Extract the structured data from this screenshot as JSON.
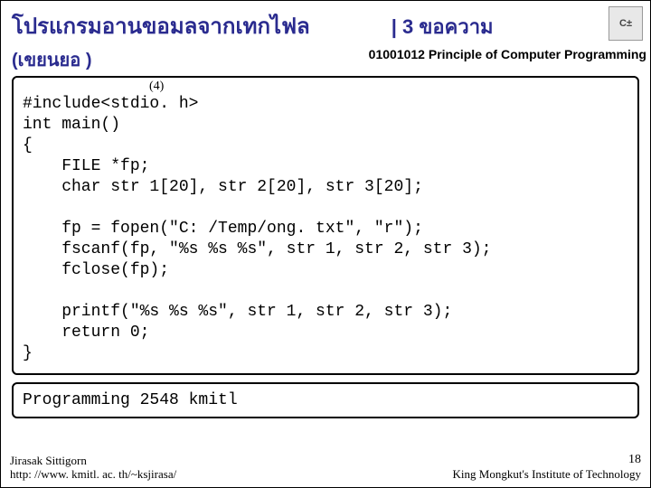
{
  "title_main": "โปรแกรมอานขอมลจากเทกไฟล",
  "title_right": "| 3 ขอความ",
  "sub_left": "(เขยนยอ    )",
  "course": "01001012 Principle of Computer Programming",
  "badge": "C±",
  "box_num": "(4)",
  "code_text": "#include<stdio. h>\nint main()\n{\n    FILE *fp;\n    char str 1[20], str 2[20], str 3[20];\n\n    fp = fopen(\"C: /Temp/ong. txt\", \"r\");\n    fscanf(fp, \"%s %s %s\", str 1, str 2, str 3);\n    fclose(fp);\n\n    printf(\"%s %s %s\", str 1, str 2, str 3);\n    return 0;\n}",
  "output_text": "Programming 2548 kmitl",
  "footer_author": "Jirasak Sittigorn",
  "footer_url": "http: //www. kmitl. ac. th/~ksjirasa/",
  "page_num": "18",
  "footer_inst": "King Mongkut's Institute of Technology"
}
